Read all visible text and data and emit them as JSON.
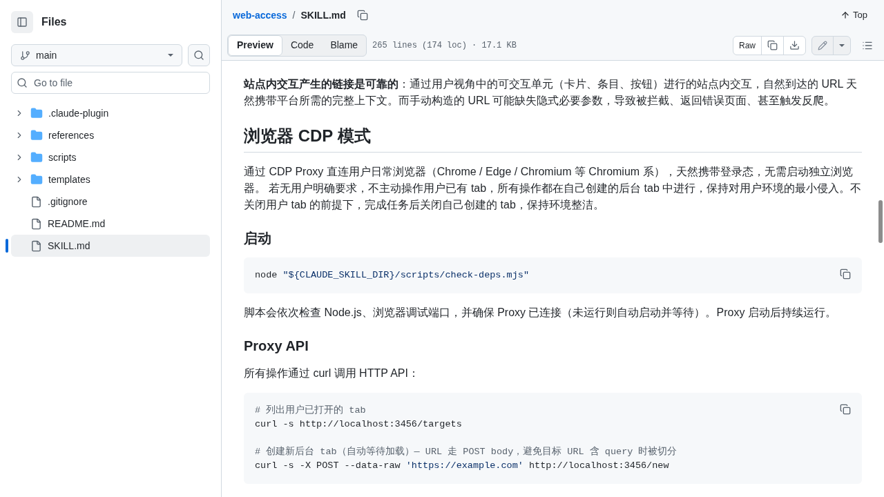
{
  "sidebar": {
    "title": "Files",
    "branch": "main",
    "search": {
      "placeholder": "Go to file"
    },
    "items": [
      {
        "kind": "folder",
        "name": ".claude-plugin",
        "expanded": false,
        "selected": false
      },
      {
        "kind": "folder",
        "name": "references",
        "expanded": false,
        "selected": false
      },
      {
        "kind": "folder",
        "name": "scripts",
        "expanded": false,
        "selected": false
      },
      {
        "kind": "folder",
        "name": "templates",
        "expanded": false,
        "selected": false
      },
      {
        "kind": "file",
        "name": ".gitignore",
        "selected": false
      },
      {
        "kind": "file",
        "name": "README.md",
        "selected": false
      },
      {
        "kind": "file",
        "name": "SKILL.md",
        "selected": true
      }
    ]
  },
  "header": {
    "repo": "web-access",
    "separator": "/",
    "file": "SKILL.md",
    "top": "Top"
  },
  "toolbar": {
    "tabs": [
      {
        "label": "Preview",
        "selected": true
      },
      {
        "label": "Code",
        "selected": false
      },
      {
        "label": "Blame",
        "selected": false
      }
    ],
    "info": "265 lines (174 loc) · 17.1 KB",
    "raw": "Raw"
  },
  "content": [
    {
      "kind": "p",
      "text": "**站点内交互产生的链接是可靠的**：通过用户视角中的可交互单元（卡片、条目、按钮）进行的站点内交互，自然到达的 URL 天然携带平台所需的完整上下文。而手动构造的 URL 可能缺失隐式必要参数，导致被拦截、返回错误页面、甚至触发反爬。"
    },
    {
      "kind": "h2",
      "text": "浏览器 CDP 模式"
    },
    {
      "kind": "p",
      "text": "通过 CDP Proxy 直连用户日常浏览器（Chrome / Edge / Chromium 等 Chromium 系），天然携带登录态，无需启动独立浏览器。 若无用户明确要求，不主动操作用户已有 tab，所有操作都在自己创建的后台 tab 中进行，保持对用户环境的最小侵入。不关闭用户 tab 的前提下，完成任务后关闭自己创建的 tab，保持环境整洁。"
    },
    {
      "kind": "h3",
      "text": "启动"
    },
    {
      "kind": "code",
      "groups": [
        [
          [
            {
              "kind": "plain",
              "text": "node "
            },
            {
              "kind": "string",
              "text": "\"${CLAUDE_SKILL_DIR}"
            },
            {
              "kind": "path",
              "text": "/scripts/check-deps.mjs"
            },
            {
              "kind": "string",
              "text": "\""
            }
          ]
        ]
      ]
    },
    {
      "kind": "p",
      "text": "脚本会依次检查 Node.js、浏览器调试端口，并确保 Proxy 已连接（未运行则自动启动并等待）。Proxy 启动后持续运行。"
    },
    {
      "kind": "h3",
      "text": "Proxy API"
    },
    {
      "kind": "p",
      "text": "所有操作通过 curl 调用 HTTP API："
    },
    {
      "kind": "code",
      "groups": [
        [
          [
            {
              "kind": "comment",
              "text": "# 列出用户已打开的 tab"
            }
          ],
          [
            {
              "kind": "plain",
              "text": "curl -s http://localhost:3456/targets"
            }
          ]
        ],
        [
          [
            {
              "kind": "comment",
              "text": "# 创建新后台 tab（自动等待加载）— URL 走 POST body，避免目标 URL 含 query 时被切分"
            }
          ],
          [
            {
              "kind": "plain",
              "text": "curl -s -X POST --data-raw "
            },
            {
              "kind": "path",
              "text": "'https://example.com'"
            },
            {
              "kind": "plain",
              "text": " http://localhost:3456/new"
            }
          ]
        ]
      ]
    }
  ]
}
